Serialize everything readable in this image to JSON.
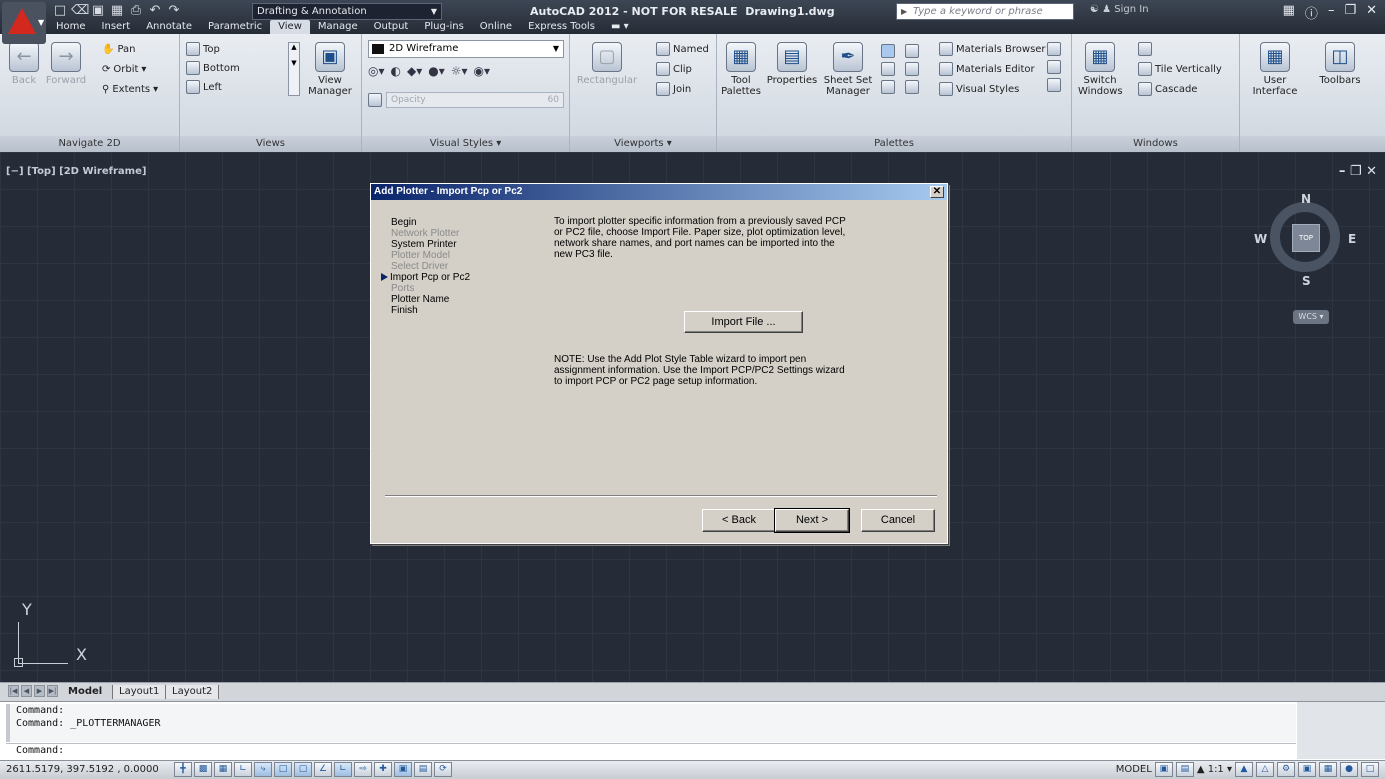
{
  "titlebar": {
    "workspace": "Drafting & Annotation",
    "app_title": "AutoCAD 2012 - NOT FOR RESALE",
    "file_name": "Drawing1.dwg",
    "search_placeholder": "Type a keyword or phrase",
    "sign_in": "Sign In"
  },
  "menu_tabs": [
    "Home",
    "Insert",
    "Annotate",
    "Parametric",
    "View",
    "Manage",
    "Output",
    "Plug-ins",
    "Online",
    "Express Tools"
  ],
  "active_tab": "View",
  "ribbon": {
    "navigate": {
      "label": "Navigate 2D",
      "back": "Back",
      "forward": "Forward",
      "pan": "Pan",
      "orbit": "Orbit",
      "extents": "Extents"
    },
    "views": {
      "label": "Views",
      "items": [
        "Top",
        "Bottom",
        "Left"
      ],
      "view_manager": "View Manager"
    },
    "visual_styles": {
      "label": "Visual Styles",
      "current": "2D Wireframe",
      "opacity_label": "Opacity",
      "opacity_value": "60"
    },
    "viewports": {
      "label": "Viewports",
      "rectangular": "Rectangular",
      "named": "Named",
      "clip": "Clip",
      "join": "Join"
    },
    "palettes": {
      "label": "Palettes",
      "tool_palettes": "Tool Palettes",
      "properties": "Properties",
      "sheet_set": "Sheet Set Manager",
      "materials_browser": "Materials Browser",
      "materials_editor": "Materials Editor",
      "visual_styles": "Visual Styles"
    },
    "windows": {
      "label": "Windows",
      "switch": "Switch Windows",
      "tile": "Tile Vertically",
      "cascade": "Cascade"
    },
    "ui": {
      "user_interface": "User Interface",
      "toolbars": "Toolbars"
    }
  },
  "viewport": {
    "label": "[−] [Top] [2D Wireframe]",
    "compass": {
      "n": "N",
      "s": "S",
      "e": "E",
      "w": "W",
      "face": "TOP"
    },
    "wcs": "WCS",
    "ucs_y": "Y",
    "ucs_x": "X"
  },
  "dialog": {
    "title": "Add Plotter - Import Pcp or Pc2",
    "steps": [
      {
        "label": "Begin",
        "state": "normal"
      },
      {
        "label": "Network Plotter",
        "state": "dim"
      },
      {
        "label": "System Printer",
        "state": "normal"
      },
      {
        "label": "Plotter Model",
        "state": "dim"
      },
      {
        "label": "Select Driver",
        "state": "dim"
      },
      {
        "label": "Import Pcp or Pc2",
        "state": "current"
      },
      {
        "label": "Ports",
        "state": "dim"
      },
      {
        "label": "Plotter Name",
        "state": "normal"
      },
      {
        "label": "Finish",
        "state": "normal"
      }
    ],
    "intro": "To import plotter specific information from a previously saved PCP or PC2 file, choose Import File. Paper size, plot optimization level, network share names, and port names can be imported into the new PC3 file.",
    "import_button": "Import File ...",
    "note": "NOTE: Use the Add Plot Style Table wizard to import pen assignment information. Use the Import PCP/PC2 Settings wizard to import PCP or PC2 page setup information.",
    "back": "< Back",
    "next": "Next >",
    "cancel": "Cancel"
  },
  "layout_tabs": [
    "Model",
    "Layout1",
    "Layout2"
  ],
  "command": {
    "history": [
      "Command:",
      "Command:  _PLOTTERMANAGER"
    ],
    "prompt": "Command:"
  },
  "status": {
    "coords": "2611.5179, 397.5192 , 0.0000",
    "model": "MODEL",
    "scale": "1:1"
  }
}
